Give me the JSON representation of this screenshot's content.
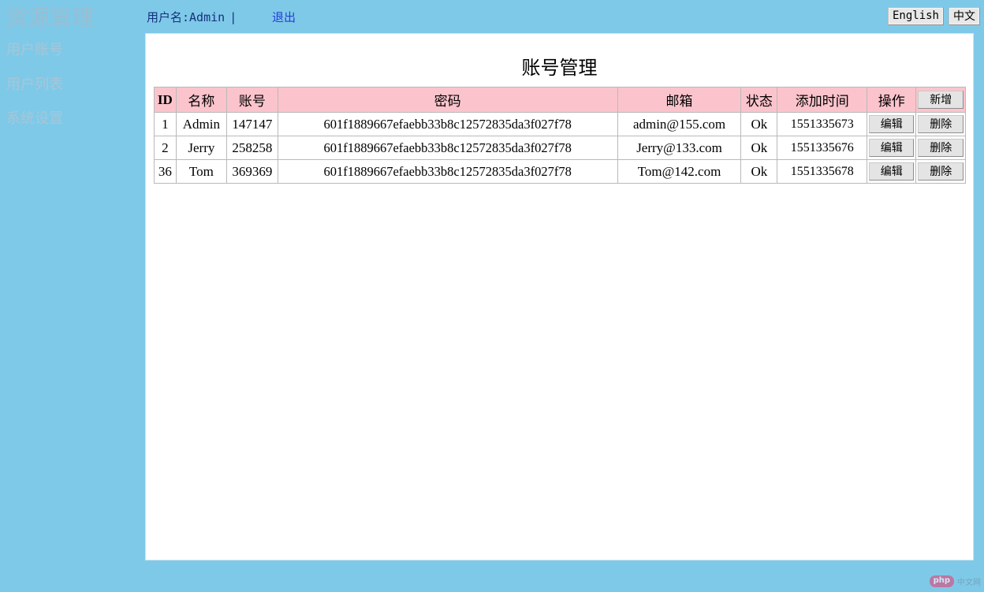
{
  "app": {
    "brand": "资源管理",
    "background_color": "#7fc9e8",
    "panel_color": "#ffffff",
    "header_row_color": "#fbc4cc"
  },
  "header": {
    "user_label": "用户名:Admin",
    "separator": "|",
    "logout_label": "退出",
    "lang_en": "English",
    "lang_cn": "中文"
  },
  "sidebar": {
    "items": [
      {
        "label": "用户账号"
      },
      {
        "label": "用户列表"
      },
      {
        "label": "系统设置"
      }
    ]
  },
  "main": {
    "title": "账号管理",
    "add_button": "新增",
    "columns": [
      "ID",
      "名称",
      "账号",
      "密码",
      "邮箱",
      "状态",
      "添加时间",
      "操作"
    ],
    "row_actions": {
      "edit": "编辑",
      "delete": "删除"
    },
    "rows": [
      {
        "id": "1",
        "name": "Admin",
        "account": "147147",
        "password": "601f1889667efaebb33b8c12572835da3f027f78",
        "email": "admin@155.com",
        "state": "Ok",
        "add_time": "1551335673"
      },
      {
        "id": "2",
        "name": "Jerry",
        "account": "258258",
        "password": "601f1889667efaebb33b8c12572835da3f027f78",
        "email": "Jerry@133.com",
        "state": "Ok",
        "add_time": "1551335676"
      },
      {
        "id": "36",
        "name": "Tom",
        "account": "369369",
        "password": "601f1889667efaebb33b8c12572835da3f027f78",
        "email": "Tom@142.com",
        "state": "Ok",
        "add_time": "1551335678"
      }
    ]
  },
  "watermark": {
    "logo": "php",
    "text": "中文网"
  }
}
